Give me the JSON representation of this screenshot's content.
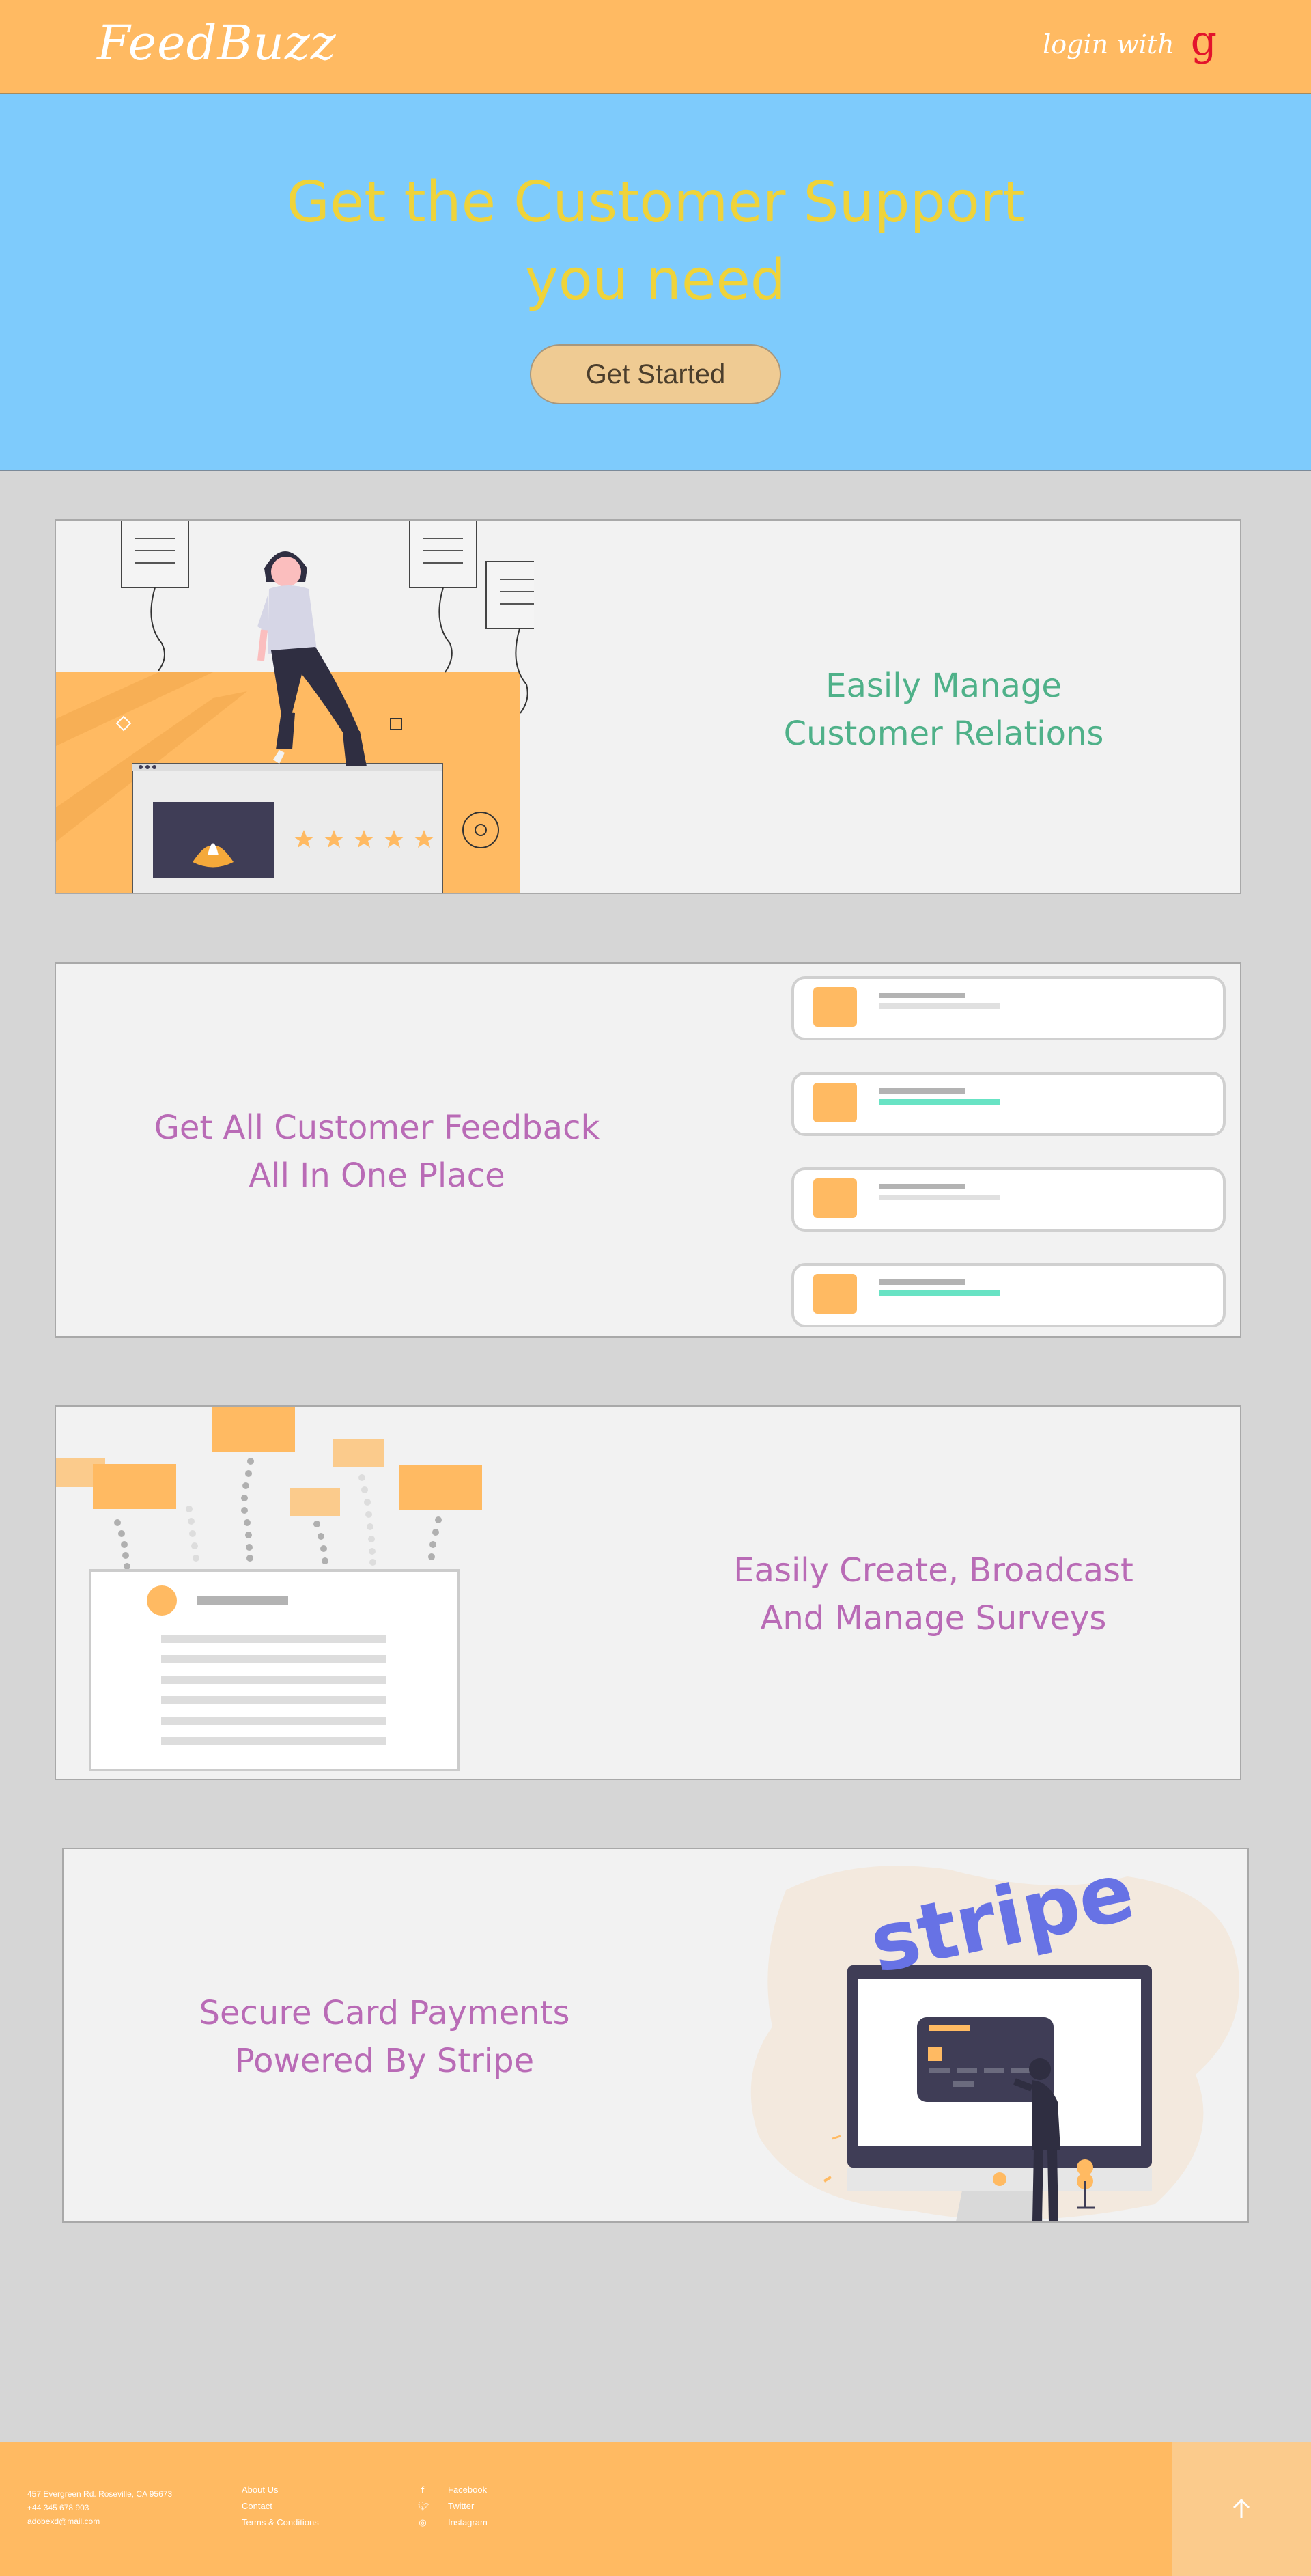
{
  "header": {
    "brand": "FeedBuzz",
    "login_label": "login with",
    "google_icon": "g"
  },
  "hero": {
    "title_line1": "Get the Customer Support",
    "title_line2": "you need",
    "cta_label": "Get Started"
  },
  "features": [
    {
      "line1": "Easily Manage",
      "line2": "Customer Relations",
      "illustration": "woman-sitting-review-icon"
    },
    {
      "line1": "Get All Customer Feedback",
      "line2": "All In One Place",
      "illustration": "feedback-cards-icon"
    },
    {
      "line1": "Easily Create, Broadcast",
      "line2": "And Manage Surveys",
      "illustration": "survey-document-icon"
    },
    {
      "line1": "Secure Card Payments",
      "line2": "Powered By Stripe",
      "illustration": "stripe-payment-icon",
      "logo_text": "stripe"
    }
  ],
  "footer": {
    "address": "457 Evergreen Rd. Roseville, CA 95673",
    "phone": "+44 345 678 903",
    "email": "adobexd@mail.com",
    "links": [
      "About Us",
      "Contact",
      "Terms & Conditions"
    ],
    "social": [
      {
        "label": "Facebook",
        "icon": "facebook-icon"
      },
      {
        "label": "Twitter",
        "icon": "twitter-icon"
      },
      {
        "label": "Instagram",
        "icon": "instagram-icon"
      }
    ],
    "back_to_top_icon": "arrow-up-icon"
  },
  "colors": {
    "header_bg": "#ffba62",
    "hero_bg": "#7ecbfc",
    "hero_title": "#efd33a",
    "cta_bg": "#efcb93",
    "page_bg": "#d6d6d6",
    "card_bg": "#f2f2f2",
    "teal_text": "#4fb189",
    "purple_text": "#b96bb6",
    "stripe_blue": "#6772e5"
  }
}
